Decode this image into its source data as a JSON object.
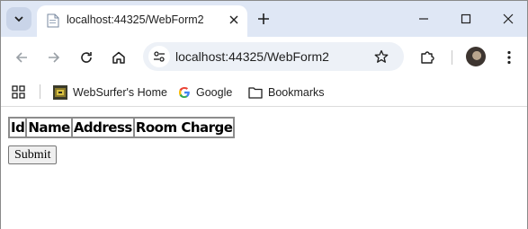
{
  "browser": {
    "tab": {
      "title": "localhost:44325/WebForm2"
    },
    "address_bar": {
      "url": "localhost:44325/WebForm2"
    },
    "bookmarks": [
      {
        "label": "WebSurfer's Home",
        "icon": "websurfer-favicon"
      },
      {
        "label": "Google",
        "icon": "google-icon"
      },
      {
        "label": "Bookmarks",
        "icon": "folder-icon"
      }
    ]
  },
  "page": {
    "table": {
      "headers": [
        "Id",
        "Name",
        "Address",
        "Room Charge"
      ]
    },
    "submit_label": "Submit"
  }
}
